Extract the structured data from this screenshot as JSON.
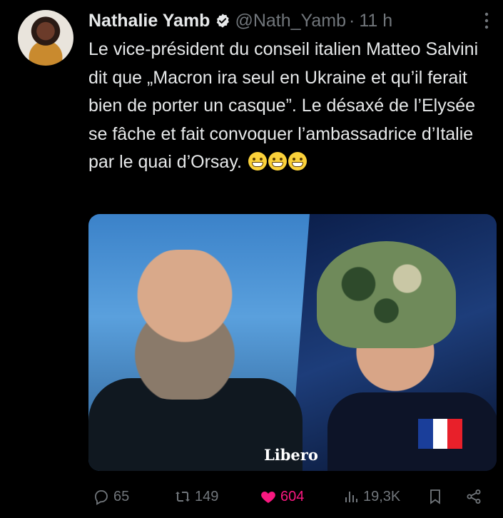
{
  "tweet": {
    "author_name": "Nathalie Yamb",
    "handle": "@Nath_Yamb",
    "separator": "·",
    "time": "11 h",
    "text": "Le vice-président du conseil italien Matteo Salvini dit que „Macron ira seul en Ukraine et qu’il ferait bien de porter un casque”. Le désaxé de l’Elysée se fâche et fait convoquer l’ambassadrice d’Italie par le quai d’Orsay.",
    "emoji_icon": "grinning-face-emoji"
  },
  "media": {
    "logo_text": "Libero",
    "flag_colors": [
      "#1a3e9a",
      "#ffffff",
      "#e8202a"
    ]
  },
  "actions": {
    "replies": "65",
    "reposts": "149",
    "likes": "604",
    "views": "19,3K"
  },
  "colors": {
    "background": "#000000",
    "text": "#e7e9ea",
    "muted": "#71767b",
    "like": "#f91880",
    "verified": "#1d9bf0"
  }
}
